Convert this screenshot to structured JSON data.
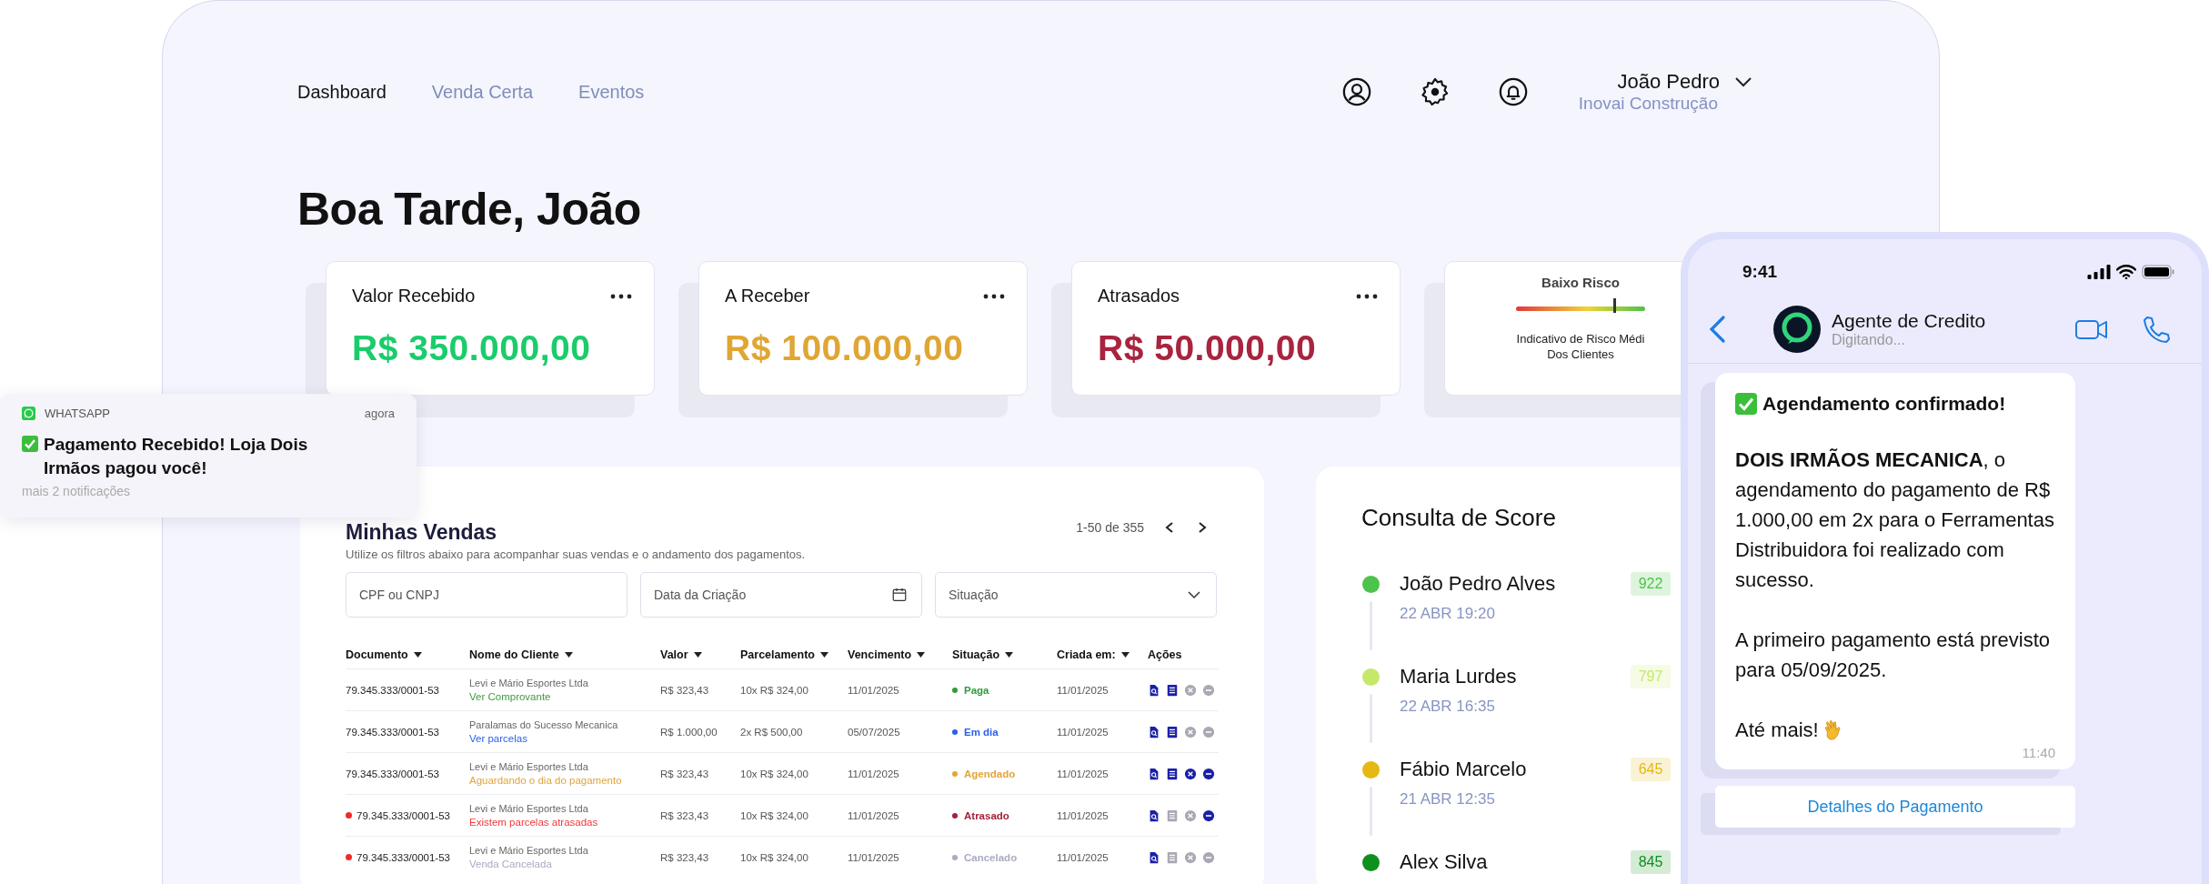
{
  "nav": {
    "tabs": [
      {
        "label": "Dashboard",
        "selected": true
      },
      {
        "label": "Venda Certa",
        "selected": false
      },
      {
        "label": "Eventos",
        "selected": false
      }
    ]
  },
  "user": {
    "name": "João Pedro",
    "company": "Inovai Construção"
  },
  "greeting": "Boa Tarde, João",
  "summary_cards": [
    {
      "kind": "amount",
      "title": "Valor Recebido",
      "value": "R$ 350.000,00",
      "color": "#1bcc6b"
    },
    {
      "kind": "amount",
      "title": "A Receber",
      "value": "R$ 100.000,00",
      "color": "#e0a634"
    },
    {
      "kind": "amount",
      "title": "Atrasados",
      "value": "R$ 50.000,00",
      "color": "#a8243f"
    },
    {
      "kind": "gauge",
      "title": "Baixo Risco",
      "level": 0.76,
      "caption_lines": [
        "Indicativo de Risco Médi",
        "Dos Clientes"
      ]
    }
  ],
  "sales": {
    "title": "Minhas Vendas",
    "subtitle": "Utilize os filtros abaixo para acompanhar suas vendas e o andamento dos pagamentos.",
    "pagination": "1-50 de 355",
    "filters": [
      {
        "kind": "text",
        "placeholder": "CPF ou CNPJ"
      },
      {
        "kind": "date",
        "placeholder": "Data da Criação"
      },
      {
        "kind": "select",
        "placeholder": "Situação"
      }
    ],
    "columns": [
      {
        "label": "Documento",
        "sortable": true
      },
      {
        "label": "Nome do Cliente",
        "sortable": true
      },
      {
        "label": "Valor",
        "sortable": true
      },
      {
        "label": "Parcelamento",
        "sortable": true
      },
      {
        "label": "Vencimento",
        "sortable": true
      },
      {
        "label": "Situação",
        "sortable": true
      },
      {
        "label": "Criada em:",
        "sortable": true
      },
      {
        "label": "Ações",
        "sortable": false
      }
    ],
    "rows": [
      {
        "document": "79.345.333/0001-53",
        "overdue": false,
        "client": "Levi e Mário Esportes Ltda",
        "note": {
          "text": "Ver Comprovante",
          "color": "#3f9d3c"
        },
        "value": "R$ 323,43",
        "installments": "10x R$ 324,00",
        "due": "11/01/2025",
        "status": {
          "label": "Paga",
          "color": "#2f9b3a"
        },
        "created": "11/01/2025",
        "actions": [
          {
            "kind": "view",
            "enabled": true
          },
          {
            "kind": "list",
            "enabled": true
          },
          {
            "kind": "cancel",
            "enabled": false
          },
          {
            "kind": "remove",
            "enabled": false
          }
        ]
      },
      {
        "document": "79.345.333/0001-53",
        "overdue": false,
        "client": "Paralamas do Sucesso Mecanica",
        "note": {
          "text": "Ver parcelas",
          "color": "#2a5fe8"
        },
        "value": "R$ 1.000,00",
        "installments": "2x R$ 500,00",
        "due": "05/07/2025",
        "status": {
          "label": "Em dia",
          "color": "#2a5fe8"
        },
        "created": "11/01/2025",
        "actions": [
          {
            "kind": "view",
            "enabled": true
          },
          {
            "kind": "list",
            "enabled": true
          },
          {
            "kind": "cancel",
            "enabled": false
          },
          {
            "kind": "remove",
            "enabled": false
          }
        ]
      },
      {
        "document": "79.345.333/0001-53",
        "overdue": false,
        "client": "Levi e Mário Esportes Ltda",
        "note": {
          "text": "Aguardando o dia do pagamento",
          "color": "#e2a43a"
        },
        "value": "R$ 323,43",
        "installments": "10x R$ 324,00",
        "due": "11/01/2025",
        "status": {
          "label": "Agendado",
          "color": "#e2a43a"
        },
        "created": "11/01/2025",
        "actions": [
          {
            "kind": "view",
            "enabled": true
          },
          {
            "kind": "list",
            "enabled": true
          },
          {
            "kind": "cancel",
            "enabled": true
          },
          {
            "kind": "remove",
            "enabled": true
          }
        ]
      },
      {
        "document": "79.345.333/0001-53",
        "overdue": true,
        "client": "Levi e Mário Esportes Ltda",
        "note": {
          "text": "Existem parcelas atrasadas",
          "color": "#f0383c"
        },
        "value": "R$ 323,43",
        "installments": "10x R$ 324,00",
        "due": "11/01/2025",
        "status": {
          "label": "Atrasado",
          "color": "#a3213a"
        },
        "created": "11/01/2025",
        "actions": [
          {
            "kind": "view",
            "enabled": true
          },
          {
            "kind": "list",
            "enabled": false
          },
          {
            "kind": "cancel",
            "enabled": false
          },
          {
            "kind": "remove",
            "enabled": true
          }
        ]
      },
      {
        "document": "79.345.333/0001-53",
        "overdue": true,
        "client": "Levi e Mário Esportes Ltda",
        "note": {
          "text": "Venda Cancelada",
          "color": "#a9abc0"
        },
        "value": "R$ 323,43",
        "installments": "10x R$ 324,00",
        "due": "11/01/2025",
        "status": {
          "label": "Cancelado",
          "color": "#a9abc0"
        },
        "created": "11/01/2025",
        "actions": [
          {
            "kind": "view",
            "enabled": true
          },
          {
            "kind": "list",
            "enabled": false
          },
          {
            "kind": "cancel",
            "enabled": false
          },
          {
            "kind": "remove",
            "enabled": false
          }
        ]
      }
    ]
  },
  "score": {
    "title": "Consulta de Score",
    "items": [
      {
        "name": "João Pedro Alves",
        "date": "22 ABR 19:20",
        "score": "922",
        "color": "#4cc34a"
      },
      {
        "name": "Maria Lurdes",
        "date": "22 ABR 16:35",
        "score": "797",
        "color": "#c6e86a"
      },
      {
        "name": "Fábio Marcelo",
        "date": "21 ABR 12:35",
        "score": "645",
        "color": "#e5b812"
      },
      {
        "name": "Alex Silva",
        "score": "845",
        "color": "#0e901c"
      }
    ]
  },
  "notification": {
    "app": "WHATSAPP",
    "time": "agora",
    "message": "Pagamento Recebido! Loja Dois Irmãos pagou você!",
    "more": "mais 2 notificações"
  },
  "phone": {
    "time": "9:41",
    "contact": {
      "name": "Agente de Credito",
      "status": "Digitando..."
    },
    "message": {
      "title": "Agendamento confirmado!",
      "paragraphs": [
        "**DOIS IRMÃOS MECANICA**, o agendamento do pagamento de R$ 1.000,00 em 2x para o Ferramentas Distribuidora foi realizado com sucesso.",
        "A primeiro pagamento está previsto para 05/09/2025."
      ],
      "sign_off": "Até mais!",
      "time": "11:40"
    },
    "action": "Detalhes do Pagamento"
  }
}
